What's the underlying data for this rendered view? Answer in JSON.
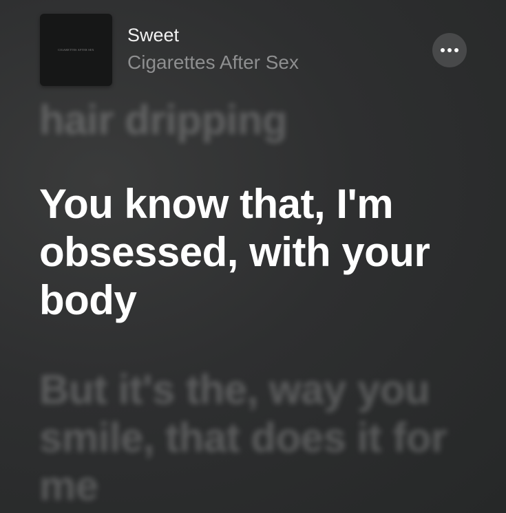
{
  "now_playing": {
    "title": "Sweet",
    "artist": "Cigarettes After Sex",
    "artwork_text": "CIGARETTES AFTER SEX",
    "more_icon": "more-horizontal-icon"
  },
  "lyrics": {
    "previous": "hair dripping",
    "current": "You know that, I'm obsessed, with your body",
    "next": "But it's the, way you smile, that does it for me"
  },
  "colors": {
    "background": "#2e2f30",
    "current_lyric": "#ffffff",
    "artist_text": "#8e8f90",
    "more_button_bg": "#48494a"
  }
}
